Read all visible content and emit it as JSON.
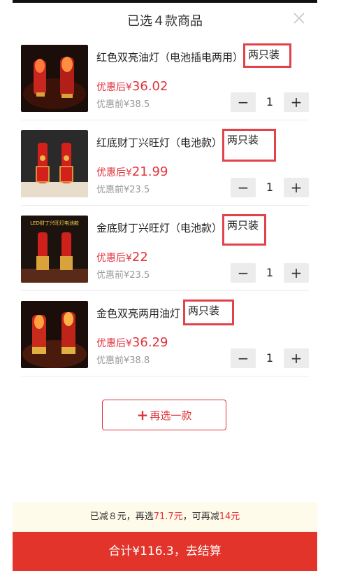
{
  "header": {
    "title": "已选４款商品"
  },
  "items": [
    {
      "name": "红色双亮油灯（电池插电两用）",
      "tag": "两只装",
      "after_label": "优惠后¥",
      "after_price": "36.02",
      "before": "优惠前¥38.5",
      "qty": "1"
    },
    {
      "name": "红底财丁兴旺灯（电池款）",
      "tag": "两只装",
      "after_label": "优惠后¥",
      "after_price": "21.99",
      "before": "优惠前¥23.5",
      "qty": "1"
    },
    {
      "name": "金底财丁兴旺灯（电池款）",
      "tag": "两只装",
      "after_label": "优惠后¥",
      "after_price": "22",
      "before": "优惠前¥23.5",
      "qty": "1"
    },
    {
      "name": "金色双亮两用油灯",
      "tag": "两只装",
      "after_label": "优惠后¥",
      "after_price": "36.29",
      "before": "优惠前¥38.8",
      "qty": "1"
    }
  ],
  "thumb_3_caption": "LED财丁兴旺灯电池款",
  "add_more": {
    "label": "再选一款"
  },
  "promo": {
    "p1": "已减８元，再选",
    "amount": "71.7元",
    "p2": "，可再减",
    "discount": "14元"
  },
  "checkout": {
    "label": "合计¥116.3，去结算"
  },
  "colors": {
    "accent": "#e0323b",
    "checkout_bg": "#e2342a",
    "promo_bg": "#fffbea",
    "highlight_box": "#e2434b"
  }
}
